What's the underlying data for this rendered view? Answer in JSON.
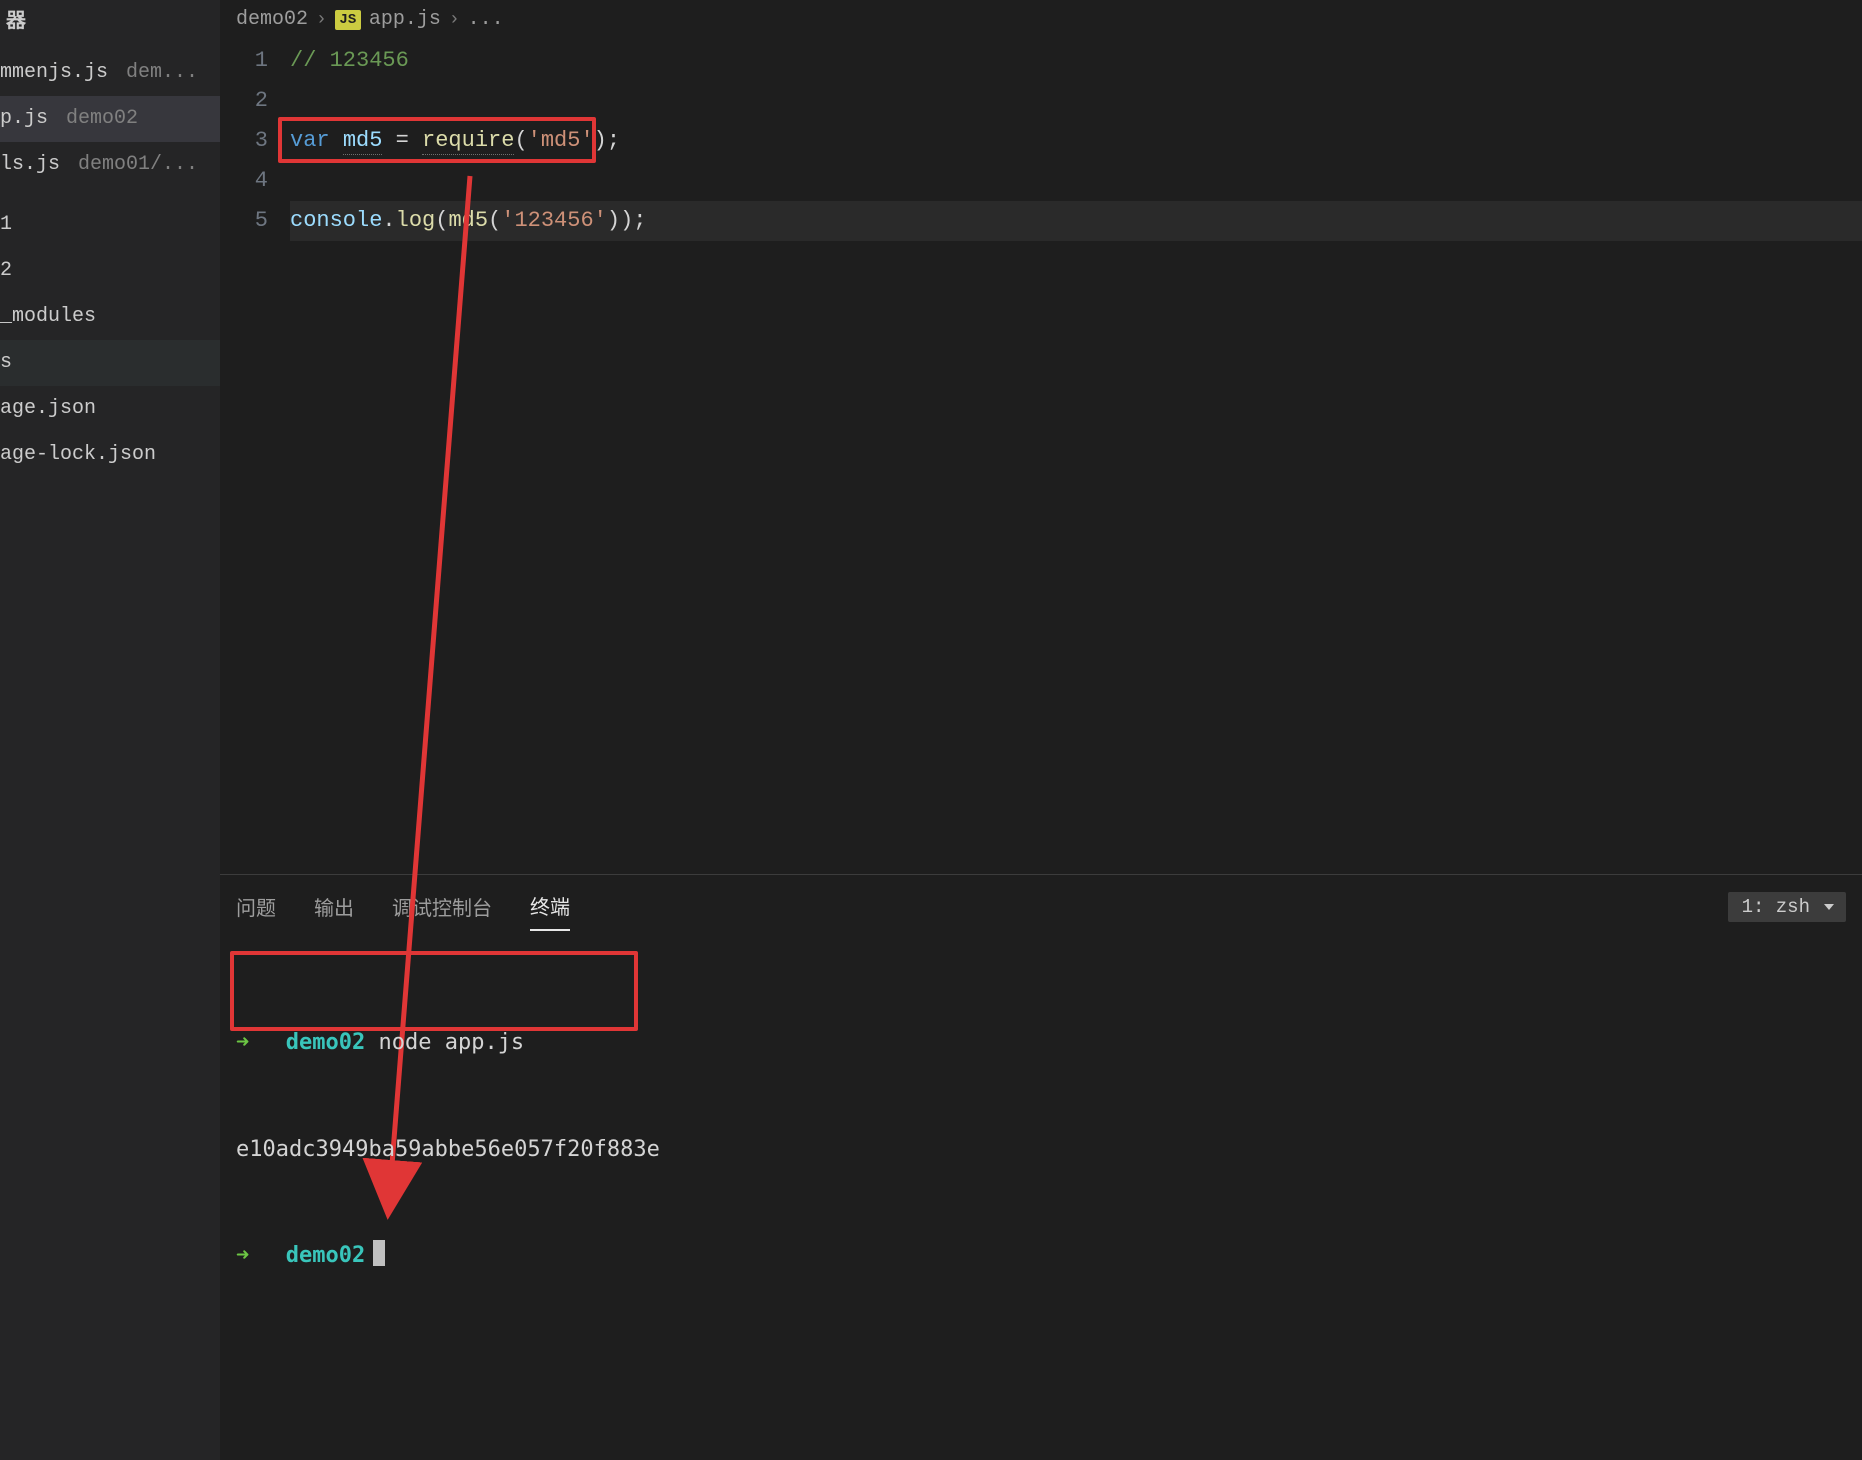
{
  "sidebar": {
    "header_fragment": "器",
    "entries": [
      {
        "name": "mmenjs.js",
        "folder": "dem..."
      },
      {
        "name": "p.js",
        "folder": "demo02"
      },
      {
        "name": "ls.js",
        "folder": "demo01/..."
      }
    ],
    "tree": [
      "1",
      "2",
      "_modules",
      "s",
      "age.json",
      "age-lock.json"
    ]
  },
  "breadcrumb": {
    "seg0": "demo02",
    "js_label": "JS",
    "seg_file": "app.js",
    "tail": "..."
  },
  "editor": {
    "lines": [
      {
        "n": "1"
      },
      {
        "n": "2"
      },
      {
        "n": "3"
      },
      {
        "n": "4"
      },
      {
        "n": "5"
      }
    ],
    "code": {
      "line1_comment": "// 123456",
      "line3_keyword": "var",
      "line3_var": "md5",
      "line3_eq": " = ",
      "line3_require": "require",
      "line3_lpar": "(",
      "line3_str": "'md5'",
      "line3_rpar": ")",
      "line3_semi": ";",
      "line5_console": "console",
      "line5_dot": ".",
      "line5_log": "log",
      "line5_lpar": "(",
      "line5_md5": "md5",
      "line5_lpar2": "(",
      "line5_str": "'123456'",
      "line5_rpar2": ")",
      "line5_rpar": ")",
      "line5_semi": ";"
    }
  },
  "panel": {
    "tabs": {
      "problems": "问题",
      "output": "输出",
      "debug": "调试控制台",
      "terminal": "终端"
    },
    "shell_select": "1: zsh"
  },
  "terminal": {
    "dir1": "demo02",
    "cmd1": "node app.js",
    "output": "e10adc3949ba59abbe56e057f20f883e",
    "dir2": "demo02"
  }
}
